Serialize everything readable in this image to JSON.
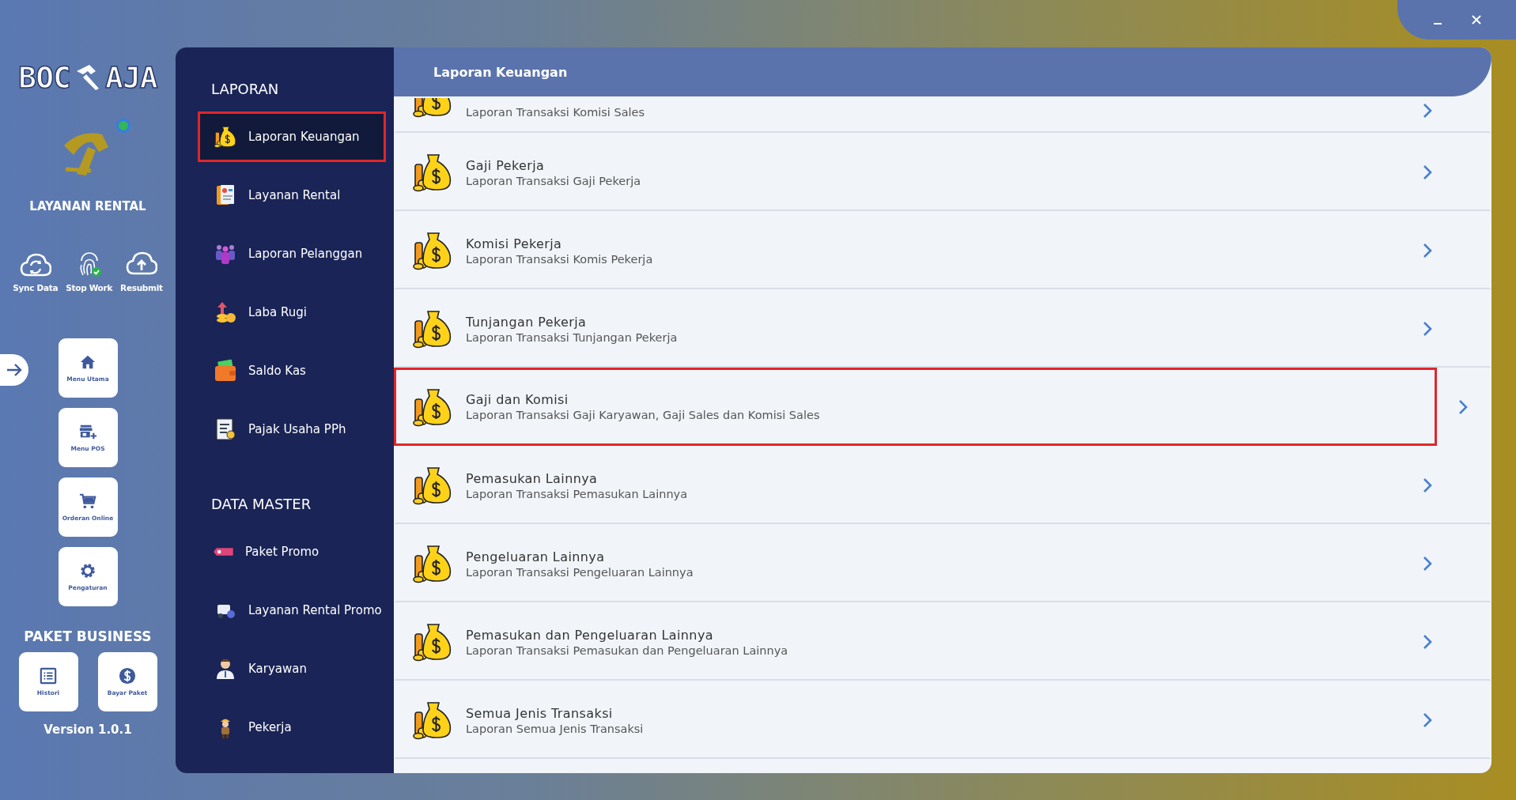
{
  "logo": {
    "left": "BOC",
    "right": "AJA"
  },
  "app": {
    "title": "LAYANAN RENTAL",
    "online": true
  },
  "quick_actions": [
    {
      "label": "Sync Data",
      "kind": "sync"
    },
    {
      "label": "Stop Work",
      "kind": "fingerprint"
    },
    {
      "label": "Resubmit",
      "kind": "upload"
    }
  ],
  "menu_buttons": [
    {
      "label": "Menu Utama",
      "kind": "home"
    },
    {
      "label": "Menu POS",
      "kind": "store"
    },
    {
      "label": "Orderan Online",
      "kind": "cart"
    },
    {
      "label": "Pengaturan",
      "kind": "gear"
    }
  ],
  "package": {
    "title": "PAKET BUSINESS",
    "buttons": [
      {
        "label": "Histori",
        "kind": "list"
      },
      {
        "label": "Bayar Paket",
        "kind": "dollar"
      }
    ]
  },
  "version": "Version 1.0.1",
  "sidebar": {
    "sections": [
      {
        "title": "LAPORAN",
        "items": [
          {
            "label": "Laporan Keuangan",
            "kind": "moneybag",
            "selected": true
          },
          {
            "label": "Layanan Rental",
            "kind": "report",
            "selected": false
          },
          {
            "label": "Laporan Pelanggan",
            "kind": "people",
            "selected": false
          },
          {
            "label": "Laba Rugi",
            "kind": "profit",
            "selected": false
          },
          {
            "label": "Saldo Kas",
            "kind": "wallet",
            "selected": false
          },
          {
            "label": "Pajak Usaha PPh",
            "kind": "tax",
            "selected": false
          }
        ]
      },
      {
        "title": "DATA MASTER",
        "items": [
          {
            "label": "Paket Promo",
            "kind": "tag",
            "selected": false
          },
          {
            "label": "Layanan Rental Promo",
            "kind": "promo",
            "selected": false
          },
          {
            "label": "Karyawan",
            "kind": "employee",
            "selected": false
          },
          {
            "label": "Pekerja",
            "kind": "worker",
            "selected": false
          }
        ]
      }
    ]
  },
  "content": {
    "title": "Laporan Keuangan",
    "rows": [
      {
        "kind": "partial",
        "subtitle": "Laporan Transaksi Komisi Sales",
        "selected": false
      },
      {
        "kind": "full",
        "title": "Gaji Pekerja",
        "subtitle": "Laporan Transaksi Gaji Pekerja",
        "selected": false
      },
      {
        "kind": "full",
        "title": "Komisi Pekerja",
        "subtitle": "Laporan Transaksi Komis Pekerja",
        "selected": false
      },
      {
        "kind": "full",
        "title": "Tunjangan Pekerja",
        "subtitle": "Laporan Transaksi Tunjangan Pekerja",
        "selected": false
      },
      {
        "kind": "full",
        "title": "Gaji dan Komisi",
        "subtitle": "Laporan Transaksi Gaji Karyawan, Gaji Sales dan Komisi Sales",
        "selected": true
      },
      {
        "kind": "full",
        "title": "Pemasukan Lainnya",
        "subtitle": "Laporan Transaksi Pemasukan Lainnya",
        "selected": false
      },
      {
        "kind": "full",
        "title": "Pengeluaran Lainnya",
        "subtitle": "Laporan Transaksi Pengeluaran Lainnya",
        "selected": false
      },
      {
        "kind": "full",
        "title": "Pemasukan dan Pengeluaran Lainnya",
        "subtitle": "Laporan Transaksi Pemasukan dan Pengeluaran Lainnya",
        "selected": false
      },
      {
        "kind": "full",
        "title": "Semua Jenis Transaksi",
        "subtitle": "Laporan Semua Jenis Transaksi",
        "selected": false
      }
    ]
  }
}
